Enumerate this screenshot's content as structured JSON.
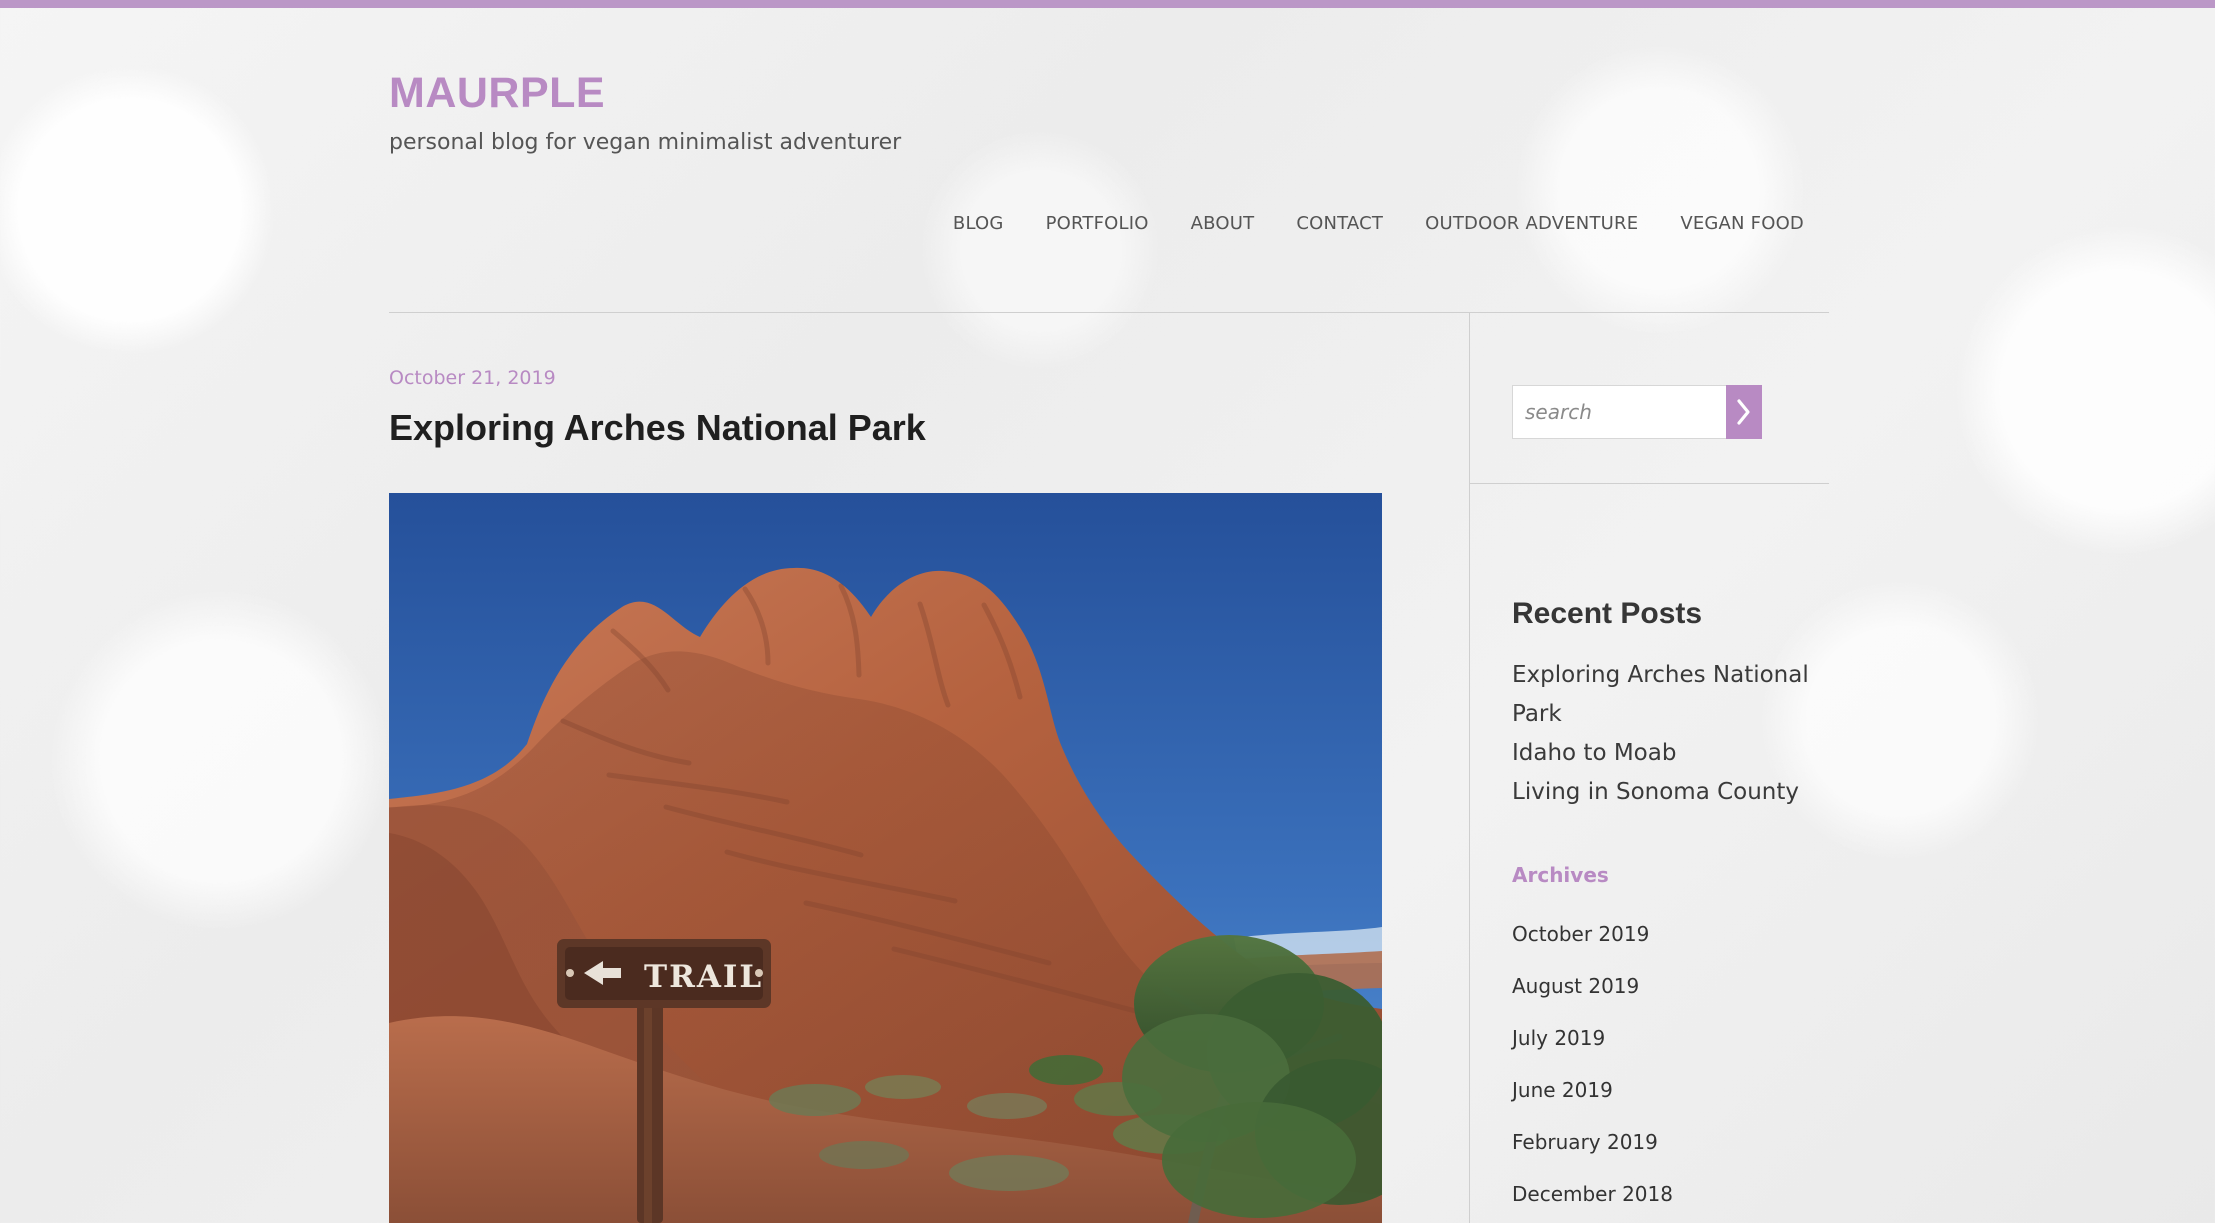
{
  "site": {
    "title": "MAURPLE",
    "tagline": "personal blog for vegan minimalist adventurer"
  },
  "nav": {
    "items": [
      {
        "label": "BLOG"
      },
      {
        "label": "PORTFOLIO"
      },
      {
        "label": "ABOUT"
      },
      {
        "label": "CONTACT"
      },
      {
        "label": "OUTDOOR ADVENTURE"
      },
      {
        "label": "VEGAN FOOD"
      }
    ]
  },
  "post": {
    "date": "October 21, 2019",
    "title": "Exploring Arches National Park",
    "image": {
      "sign_text": "TRAIL",
      "icon": "trail-sign-icon"
    }
  },
  "sidebar": {
    "search": {
      "placeholder": "search",
      "button_icon": "chevron-right-icon"
    },
    "recent_posts": {
      "heading": "Recent Posts",
      "items": [
        {
          "label": "Exploring Arches National Park"
        },
        {
          "label": "Idaho to Moab"
        },
        {
          "label": "Living in Sonoma County"
        }
      ]
    },
    "archives": {
      "heading": "Archives",
      "items": [
        {
          "label": "October 2019"
        },
        {
          "label": "August 2019"
        },
        {
          "label": "July 2019"
        },
        {
          "label": "June 2019"
        },
        {
          "label": "February 2019"
        },
        {
          "label": "December 2018"
        }
      ]
    }
  },
  "colors": {
    "accent": "#b88ac3",
    "top_bar": "#bb97c7",
    "text_dark": "#1f1f1f",
    "text_body": "#444444",
    "divider": "#cfcfcf"
  }
}
